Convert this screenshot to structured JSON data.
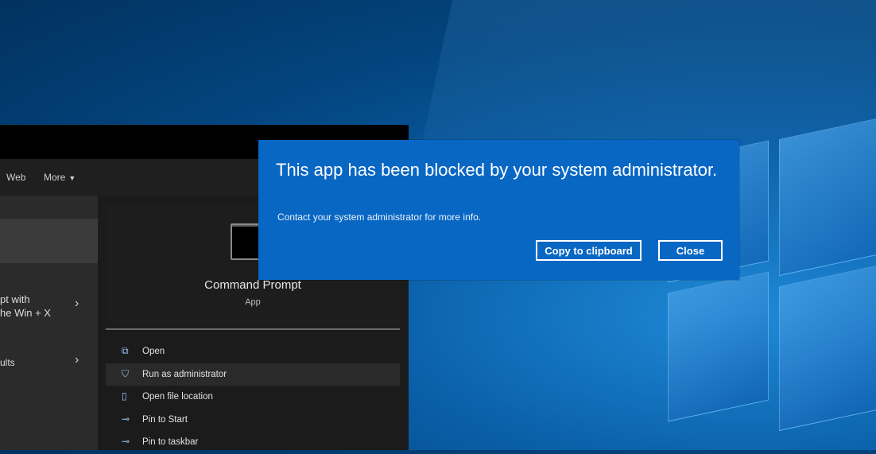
{
  "start_menu": {
    "tabs": {
      "web": "Web",
      "more": "More",
      "more_caret": "▼"
    },
    "left_items": [
      {
        "label": "pt with\nhe Win + X",
        "chevron": "›"
      },
      {
        "label": "ults",
        "chevron": "›"
      }
    ],
    "app": {
      "name": "Command Prompt",
      "type": "App"
    },
    "actions": [
      {
        "label": "Open",
        "icon": "open-icon",
        "glyph": "⧉"
      },
      {
        "label": "Run as administrator",
        "icon": "shield-icon",
        "glyph": "⛉"
      },
      {
        "label": "Open file location",
        "icon": "file-icon",
        "glyph": "▯"
      },
      {
        "label": "Pin to Start",
        "icon": "pin-icon",
        "glyph": "⊸"
      },
      {
        "label": "Pin to taskbar",
        "icon": "pin-icon",
        "glyph": "⊸"
      }
    ]
  },
  "dialog": {
    "title": "This app has been blocked by your system administrator.",
    "message": "Contact your system administrator for more info.",
    "copy_button": "Copy to clipboard",
    "close_button": "Close"
  },
  "colors": {
    "dialog_bg": "#0967c4",
    "desktop_accent": "#1f8ad8"
  }
}
